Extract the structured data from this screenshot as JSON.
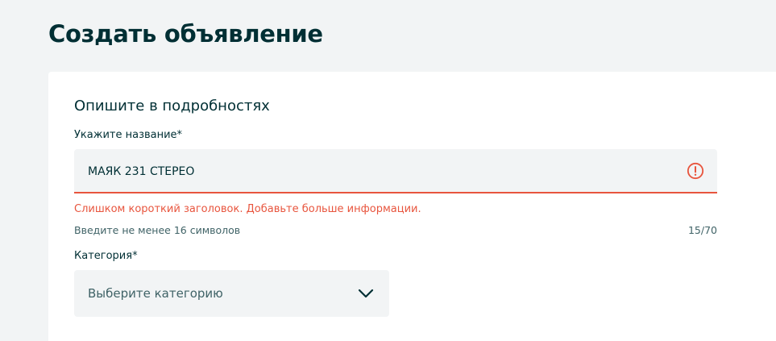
{
  "page": {
    "title": "Создать объявление"
  },
  "form": {
    "section_title": "Опишите в подробностях",
    "title_field": {
      "label": "Укажите название*",
      "value": "МАЯК 231 СТЕРЕО",
      "error": "Слишком короткий заголовок. Добавьте больше информации.",
      "hint": "Введите не менее 16 символов",
      "counter": "15/70"
    },
    "category_field": {
      "label": "Категория*",
      "placeholder": "Выберите категорию"
    }
  },
  "colors": {
    "background": "#f2f4f5",
    "text": "#002f34",
    "error": "#e8553e"
  },
  "icons": {
    "error": "error-circle-exclamation",
    "dropdown": "chevron-down"
  }
}
